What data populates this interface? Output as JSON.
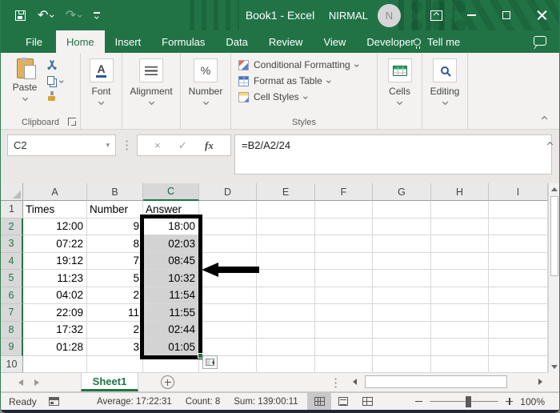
{
  "window": {
    "title": "Book1 - Excel",
    "user": "NIRMAL",
    "avatar_initial": "N"
  },
  "tabs": {
    "items": [
      "File",
      "Home",
      "Insert",
      "Formulas",
      "Data",
      "Review",
      "View",
      "Developer"
    ],
    "active": "Home",
    "tell_me": "Tell me"
  },
  "ribbon": {
    "paste_label": "Paste",
    "font_label": "Font",
    "alignment_label": "Alignment",
    "number_label": "Number",
    "styles_items": [
      "Conditional Formatting",
      "Format as Table",
      "Cell Styles"
    ],
    "cells_label": "Cells",
    "editing_label": "Editing",
    "group_labels": {
      "clipboard": "Clipboard",
      "styles": "Styles"
    }
  },
  "icons": {
    "undo": "↶",
    "redo": "↷",
    "name_box_dropdown": "▾",
    "cancel": "×",
    "enter": "✓",
    "insert_function": "fx"
  },
  "formula_bar": {
    "name_box": "C2",
    "formula": "=B2/A2/24"
  },
  "grid": {
    "columns": [
      "A",
      "B",
      "C",
      "D",
      "E",
      "F",
      "G",
      "H",
      "I"
    ],
    "selection": {
      "range": "C2:C9",
      "column": "C",
      "first_row": 2,
      "last_row": 9,
      "active_cell": "C2"
    },
    "rows": [
      {
        "n": "1",
        "cells": [
          "Times",
          "Number",
          "Answer",
          "",
          "",
          "",
          "",
          "",
          ""
        ]
      },
      {
        "n": "2",
        "cells": [
          "12:00",
          "9",
          "18:00",
          "",
          "",
          "",
          "",
          "",
          ""
        ]
      },
      {
        "n": "3",
        "cells": [
          "07:22",
          "8",
          "02:03",
          "",
          "",
          "",
          "",
          "",
          ""
        ]
      },
      {
        "n": "4",
        "cells": [
          "19:12",
          "7",
          "08:45",
          "",
          "",
          "",
          "",
          "",
          ""
        ]
      },
      {
        "n": "5",
        "cells": [
          "11:23",
          "5",
          "10:32",
          "",
          "",
          "",
          "",
          "",
          ""
        ]
      },
      {
        "n": "6",
        "cells": [
          "04:02",
          "2",
          "11:54",
          "",
          "",
          "",
          "",
          "",
          ""
        ]
      },
      {
        "n": "7",
        "cells": [
          "22:09",
          "11",
          "11:55",
          "",
          "",
          "",
          "",
          "",
          ""
        ]
      },
      {
        "n": "8",
        "cells": [
          "17:32",
          "2",
          "02:44",
          "",
          "",
          "",
          "",
          "",
          ""
        ]
      },
      {
        "n": "9",
        "cells": [
          "01:28",
          "3",
          "01:05",
          "",
          "",
          "",
          "",
          "",
          ""
        ]
      },
      {
        "n": "10",
        "cells": [
          "",
          "",
          "",
          "",
          "",
          "",
          "",
          "",
          ""
        ]
      }
    ]
  },
  "sheet_bar": {
    "active_tab": "Sheet1"
  },
  "status_bar": {
    "mode": "Ready",
    "average": "Average: 17:22:31",
    "count": "Count: 8",
    "sum": "Sum: 139:00:11",
    "zoom_level": "100%"
  },
  "colors": {
    "accent_green": "#217346",
    "title_bar": "#217346",
    "selection_fill": "#d3d3d3"
  }
}
